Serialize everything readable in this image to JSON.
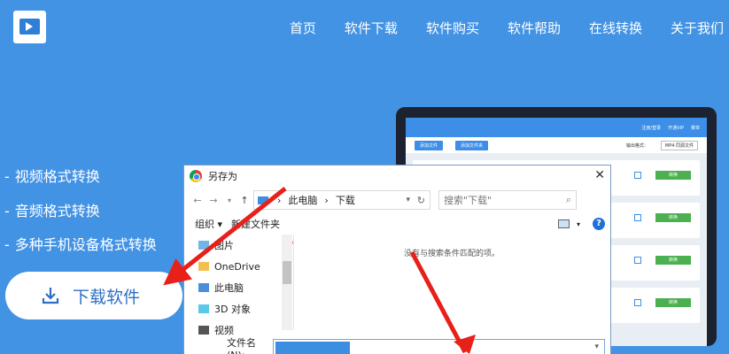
{
  "nav": {
    "items": [
      "首页",
      "软件下载",
      "软件购买",
      "软件帮助",
      "在线转换",
      "关于我们"
    ]
  },
  "features": [
    "视频格式转换",
    "音频格式转换",
    "多种手机设备格式转换"
  ],
  "download_button": {
    "label": "下载软件"
  },
  "app_preview": {
    "top_links": [
      "注册/登录",
      "开通VIP",
      "菜单"
    ],
    "toolbar_buttons": [
      "添加文件",
      "添加文件夹"
    ],
    "format_label": "输出格式：",
    "format_value": "MP4 同源文件",
    "convert_label": "转换"
  },
  "dialog": {
    "title": "另存为",
    "path": [
      "此电脑",
      "下载"
    ],
    "search_placeholder": "搜索\"下载\"",
    "organize": "组织 ▾",
    "new_folder": "新建文件夹",
    "sidebar": [
      {
        "label": "图片",
        "icon": "pictures-icon"
      },
      {
        "label": "OneDrive",
        "icon": "onedrive-icon"
      },
      {
        "label": "此电脑",
        "icon": "pc-icon"
      },
      {
        "label": "3D 对象",
        "icon": "3d-objects-icon"
      },
      {
        "label": "视频",
        "icon": "video-icon"
      }
    ],
    "empty_message": "没有与搜索条件匹配的项。",
    "filename_label": "文件名(N):"
  },
  "colors": {
    "background": "#4393e4",
    "arrow": "#e8201a",
    "button_text": "#2d6fc4"
  }
}
